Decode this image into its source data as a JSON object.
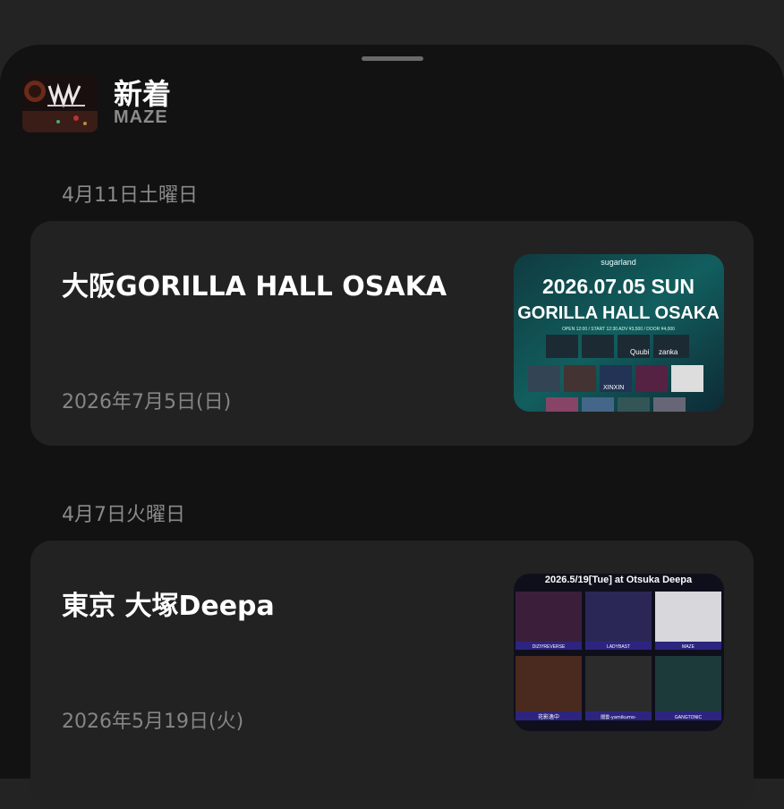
{
  "header": {
    "title": "新着",
    "subtitle": "MAZE",
    "avatar_icon": "band-logo-icon"
  },
  "sections": [
    {
      "date_label": "4月11日土曜日",
      "event": {
        "title": "大阪GORILLA HALL OSAKA",
        "date": "2026年7月5日(日)",
        "flyer": {
          "brand": "sugarland",
          "headline1": "2026.07.05 SUN",
          "headline2": "GORILLA HALL OSAKA",
          "info": "OPEN 12:00 / START 12:30   ADV ¥3,500 / DOOR ¥4,000",
          "acts": [
            "Quubi",
            "zanka",
            "XINXIN"
          ]
        }
      }
    },
    {
      "date_label": "4月7日火曜日",
      "event": {
        "title": "東京 大塚Deepa",
        "date": "2026年5月19日(火)",
        "flyer": {
          "headline": "2026.5/19[Tue] at Otsuka Deepa",
          "bands": [
            "DIZIYREVERSE",
            "LADYBAST",
            "MAZE",
            "花影逸中",
            "闇雲-yamikumo-",
            "GANGTONIC"
          ]
        }
      }
    }
  ],
  "colors": {
    "background": "#232323",
    "sheet": "#121212",
    "card": "#222222",
    "secondary_text": "#8a8a8a"
  }
}
